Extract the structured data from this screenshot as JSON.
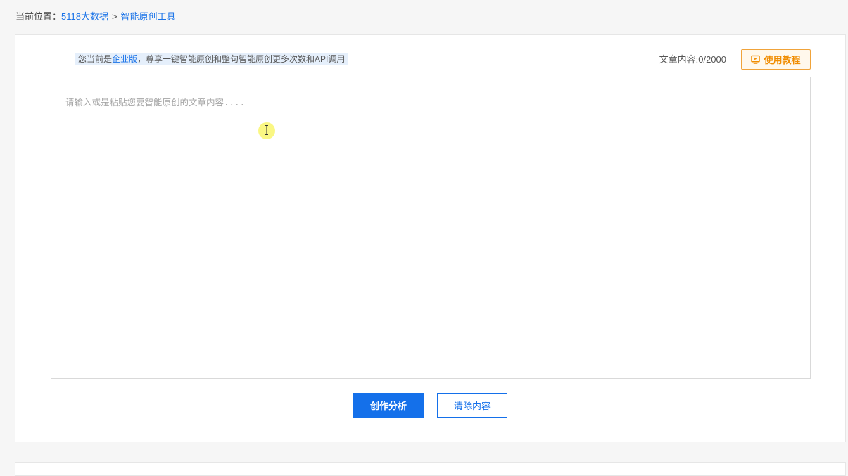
{
  "breadcrumb": {
    "prefix": "当前位置：",
    "items": [
      {
        "label": "5118大数据"
      },
      {
        "label": "智能原创工具"
      }
    ],
    "separator": ">"
  },
  "notice": {
    "before": "您当前是",
    "highlight": "企业版",
    "after": "，尊享一键智能原创和整句智能原创更多次数和API调用"
  },
  "editor": {
    "counter": "文章内容:0/2000",
    "placeholder": "请输入或是粘贴您要智能原创的文章内容....",
    "value": ""
  },
  "tutorial": {
    "label": "使用教程",
    "icon": "play-screen-icon"
  },
  "actions": {
    "analyze_label": "创作分析",
    "clear_label": "清除内容"
  },
  "colors": {
    "accent": "#1470ea",
    "tutorial": "#f08c00",
    "notice_bg": "#e5effb"
  }
}
